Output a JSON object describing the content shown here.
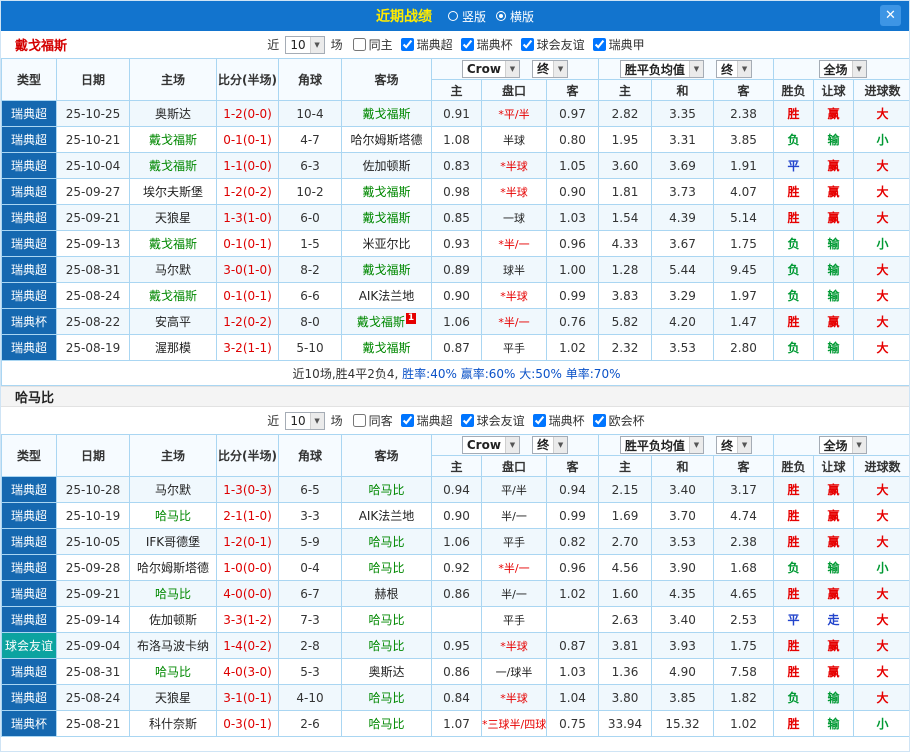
{
  "topbar": {
    "title": "近期战绩",
    "radios": [
      {
        "label": "竖版",
        "selected": false
      },
      {
        "label": "横版",
        "selected": true
      }
    ],
    "close_icon": "✕"
  },
  "colors": {
    "league_blue": "#1568B0",
    "league_teal": "#0CA3A0",
    "win_red": "#E60000",
    "lose_green": "#009933",
    "draw_blue": "#2244CC",
    "focus_green": "#008800",
    "score_red": "#DD0000",
    "summary_blue": "#0B52C8",
    "text_dark": "#333333"
  },
  "table_header": {
    "selects": {
      "odds": "Crow",
      "final1": "终",
      "avg": "胜平负均值",
      "final2": "终",
      "scope": "全场"
    },
    "cols": {
      "type": "类型",
      "date": "日期",
      "home": "主场",
      "score": "比分(半场)",
      "corner": "角球",
      "away": "客场",
      "h": "主",
      "handicap": "盘口",
      "a": "客",
      "avg_h": "主",
      "avg_d": "和",
      "avg_a": "客",
      "result": "胜负",
      "let_goal": "让球",
      "goals": "进球数"
    }
  },
  "sections": [
    {
      "team": "戴戈福斯",
      "team_color": "#D40000",
      "filter": {
        "near": "近",
        "count": "10",
        "games": "场",
        "same": {
          "label": "同主",
          "checked": false
        },
        "leagues": [
          {
            "label": "瑞典超",
            "checked": true
          },
          {
            "label": "瑞典杯",
            "checked": true
          },
          {
            "label": "球会友谊",
            "checked": true
          },
          {
            "label": "瑞典甲",
            "checked": true
          }
        ]
      },
      "rows": [
        {
          "league": "瑞典超",
          "date": "25-10-25",
          "home": "奥斯达",
          "home_focus": false,
          "score": "1-2(0-0)",
          "corner": "10-4",
          "away": "戴戈福斯",
          "away_focus": true,
          "h": "0.91",
          "handicap": "*平/半",
          "a": "0.97",
          "eh": "2.82",
          "ed": "3.35",
          "ea": "2.38",
          "r1": "胜",
          "r2": "赢",
          "r3": "大"
        },
        {
          "league": "瑞典超",
          "date": "25-10-21",
          "home": "戴戈福斯",
          "home_focus": true,
          "score": "0-1(0-1)",
          "corner": "4-7",
          "away": "哈尔姆斯塔德",
          "away_focus": false,
          "h": "1.08",
          "handicap": "半球",
          "a": "0.80",
          "eh": "1.95",
          "ed": "3.31",
          "ea": "3.85",
          "r1": "负",
          "r2": "输",
          "r3": "小"
        },
        {
          "league": "瑞典超",
          "date": "25-10-04",
          "home": "戴戈福斯",
          "home_focus": true,
          "score": "1-1(0-0)",
          "corner": "6-3",
          "away": "佐加顿斯",
          "away_focus": false,
          "h": "0.83",
          "handicap": "*半球",
          "a": "1.05",
          "eh": "3.60",
          "ed": "3.69",
          "ea": "1.91",
          "r1": "平",
          "r2": "赢",
          "r3": "大"
        },
        {
          "league": "瑞典超",
          "date": "25-09-27",
          "home": "埃尔夫斯堡",
          "home_focus": false,
          "score": "1-2(0-2)",
          "corner": "10-2",
          "away": "戴戈福斯",
          "away_focus": true,
          "h": "0.98",
          "handicap": "*半球",
          "a": "0.90",
          "eh": "1.81",
          "ed": "3.73",
          "ea": "4.07",
          "r1": "胜",
          "r2": "赢",
          "r3": "大"
        },
        {
          "league": "瑞典超",
          "date": "25-09-21",
          "home": "天狼星",
          "home_focus": false,
          "score": "1-3(1-0)",
          "corner": "6-0",
          "away": "戴戈福斯",
          "away_focus": true,
          "h": "0.85",
          "handicap": "一球",
          "a": "1.03",
          "eh": "1.54",
          "ed": "4.39",
          "ea": "5.14",
          "r1": "胜",
          "r2": "赢",
          "r3": "大"
        },
        {
          "league": "瑞典超",
          "date": "25-09-13",
          "home": "戴戈福斯",
          "home_focus": true,
          "score": "0-1(0-1)",
          "corner": "1-5",
          "away": "米亚尔比",
          "away_focus": false,
          "h": "0.93",
          "handicap": "*半/一",
          "a": "0.96",
          "eh": "4.33",
          "ed": "3.67",
          "ea": "1.75",
          "r1": "负",
          "r2": "输",
          "r3": "小"
        },
        {
          "league": "瑞典超",
          "date": "25-08-31",
          "home": "马尔默",
          "home_focus": false,
          "score": "3-0(1-0)",
          "corner": "8-2",
          "away": "戴戈福斯",
          "away_focus": true,
          "h": "0.89",
          "handicap": "球半",
          "a": "1.00",
          "eh": "1.28",
          "ed": "5.44",
          "ea": "9.45",
          "r1": "负",
          "r2": "输",
          "r3": "大"
        },
        {
          "league": "瑞典超",
          "date": "25-08-24",
          "home": "戴戈福斯",
          "home_focus": true,
          "score": "0-1(0-1)",
          "corner": "6-6",
          "away": "AIK法兰地",
          "away_focus": false,
          "h": "0.90",
          "handicap": "*半球",
          "a": "0.99",
          "eh": "3.83",
          "ed": "3.29",
          "ea": "1.97",
          "r1": "负",
          "r2": "输",
          "r3": "大"
        },
        {
          "league": "瑞典杯",
          "date": "25-08-22",
          "home": "安高平",
          "home_focus": false,
          "score": "1-2(0-2)",
          "corner": "8-0",
          "away": "戴戈福斯",
          "away_focus": true,
          "away_badge": "1",
          "h": "1.06",
          "handicap": "*半/一",
          "a": "0.76",
          "eh": "5.82",
          "ed": "4.20",
          "ea": "1.47",
          "r1": "胜",
          "r2": "赢",
          "r3": "大"
        },
        {
          "league": "瑞典超",
          "date": "25-08-19",
          "home": "渥那模",
          "home_focus": false,
          "score": "3-2(1-1)",
          "corner": "5-10",
          "away": "戴戈福斯",
          "away_focus": true,
          "h": "0.87",
          "handicap": "平手",
          "a": "1.02",
          "eh": "2.32",
          "ed": "3.53",
          "ea": "2.80",
          "r1": "负",
          "r2": "输",
          "r3": "大"
        }
      ],
      "summary": [
        {
          "text": "近10场,胜4平2负4, ",
          "color": "#333333"
        },
        {
          "text": "胜率:40% ",
          "color": "#0B52C8"
        },
        {
          "text": "赢率:60% ",
          "color": "#0B52C8"
        },
        {
          "text": "大:50% ",
          "color": "#0B52C8"
        },
        {
          "text": "单率:70%",
          "color": "#0B52C8"
        }
      ]
    },
    {
      "team": "哈马比",
      "team_color": "#222222",
      "filter": {
        "near": "近",
        "count": "10",
        "games": "场",
        "same": {
          "label": "同客",
          "checked": false
        },
        "leagues": [
          {
            "label": "瑞典超",
            "checked": true
          },
          {
            "label": "球会友谊",
            "checked": true
          },
          {
            "label": "瑞典杯",
            "checked": true
          },
          {
            "label": "欧会杯",
            "checked": true
          }
        ]
      },
      "rows": [
        {
          "league": "瑞典超",
          "date": "25-10-28",
          "home": "马尔默",
          "home_focus": false,
          "score": "1-3(0-3)",
          "corner": "6-5",
          "away": "哈马比",
          "away_focus": true,
          "h": "0.94",
          "handicap": "平/半",
          "a": "0.94",
          "eh": "2.15",
          "ed": "3.40",
          "ea": "3.17",
          "r1": "胜",
          "r2": "赢",
          "r3": "大"
        },
        {
          "league": "瑞典超",
          "date": "25-10-19",
          "home": "哈马比",
          "home_focus": true,
          "score": "2-1(1-0)",
          "corner": "3-3",
          "away": "AIK法兰地",
          "away_focus": false,
          "h": "0.90",
          "handicap": "半/一",
          "a": "0.99",
          "eh": "1.69",
          "ed": "3.70",
          "ea": "4.74",
          "r1": "胜",
          "r2": "赢",
          "r3": "大"
        },
        {
          "league": "瑞典超",
          "date": "25-10-05",
          "home": "IFK哥德堡",
          "home_focus": false,
          "score": "1-2(0-1)",
          "corner": "5-9",
          "away": "哈马比",
          "away_focus": true,
          "h": "1.06",
          "handicap": "平手",
          "a": "0.82",
          "eh": "2.70",
          "ed": "3.53",
          "ea": "2.38",
          "r1": "胜",
          "r2": "赢",
          "r3": "大"
        },
        {
          "league": "瑞典超",
          "date": "25-09-28",
          "home": "哈尔姆斯塔德",
          "home_focus": false,
          "score": "1-0(0-0)",
          "corner": "0-4",
          "away": "哈马比",
          "away_focus": true,
          "h": "0.92",
          "handicap": "*半/一",
          "a": "0.96",
          "eh": "4.56",
          "ed": "3.90",
          "ea": "1.68",
          "r1": "负",
          "r2": "输",
          "r3": "小"
        },
        {
          "league": "瑞典超",
          "date": "25-09-21",
          "home": "哈马比",
          "home_focus": true,
          "score": "4-0(0-0)",
          "corner": "6-7",
          "away": "赫根",
          "away_focus": false,
          "h": "0.86",
          "handicap": "半/一",
          "a": "1.02",
          "eh": "1.60",
          "ed": "4.35",
          "ea": "4.65",
          "r1": "胜",
          "r2": "赢",
          "r3": "大"
        },
        {
          "league": "瑞典超",
          "date": "25-09-14",
          "home": "佐加顿斯",
          "home_focus": false,
          "score": "3-3(1-2)",
          "corner": "7-3",
          "away": "哈马比",
          "away_focus": true,
          "h": "",
          "handicap": "平手",
          "a": "",
          "eh": "2.63",
          "ed": "3.40",
          "ea": "2.53",
          "r1": "平",
          "r2": "走",
          "r3": "大"
        },
        {
          "league": "球会友谊",
          "date": "25-09-04",
          "home": "布洛马波卡纳",
          "home_focus": false,
          "score": "1-4(0-2)",
          "corner": "2-8",
          "away": "哈马比",
          "away_focus": true,
          "h": "0.95",
          "handicap": "*半球",
          "a": "0.87",
          "eh": "3.81",
          "ed": "3.93",
          "ea": "1.75",
          "r1": "胜",
          "r2": "赢",
          "r3": "大"
        },
        {
          "league": "瑞典超",
          "date": "25-08-31",
          "home": "哈马比",
          "home_focus": true,
          "score": "4-0(3-0)",
          "corner": "5-3",
          "away": "奥斯达",
          "away_focus": false,
          "h": "0.86",
          "handicap": "一/球半",
          "a": "1.03",
          "eh": "1.36",
          "ed": "4.90",
          "ea": "7.58",
          "r1": "胜",
          "r2": "赢",
          "r3": "大"
        },
        {
          "league": "瑞典超",
          "date": "25-08-24",
          "home": "天狼星",
          "home_focus": false,
          "score": "3-1(0-1)",
          "corner": "4-10",
          "away": "哈马比",
          "away_focus": true,
          "h": "0.84",
          "handicap": "*半球",
          "a": "1.04",
          "eh": "3.80",
          "ed": "3.85",
          "ea": "1.82",
          "r1": "负",
          "r2": "输",
          "r3": "大"
        },
        {
          "league": "瑞典杯",
          "date": "25-08-21",
          "home": "科什奈斯",
          "home_focus": false,
          "score": "0-3(0-1)",
          "corner": "2-6",
          "away": "哈马比",
          "away_focus": true,
          "h": "1.07",
          "handicap": "*三球半/四球",
          "a": "0.75",
          "eh": "33.94",
          "ed": "15.32",
          "ea": "1.02",
          "r1": "胜",
          "r2": "输",
          "r3": "小"
        }
      ]
    }
  ]
}
